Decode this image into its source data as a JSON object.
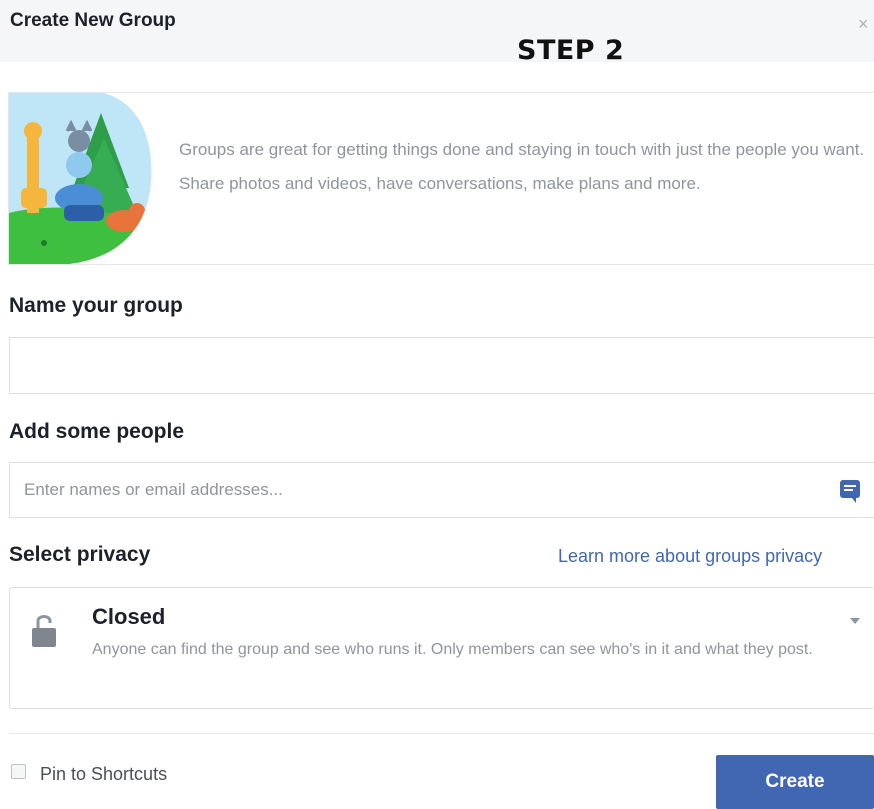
{
  "dialog": {
    "title": "Create New Group",
    "close_glyph": "×",
    "step_label": "STEP 2",
    "intro_text": "Groups are great for getting things done and staying in touch with just the people you want. Share photos and videos, have conversations, make plans and more.",
    "illustration_icon": "animals-illustration"
  },
  "name_section": {
    "label": "Name your group",
    "value": "",
    "placeholder": ""
  },
  "people_section": {
    "label": "Add some people",
    "value": "",
    "placeholder": "Enter names or email addresses...",
    "icon": "contacts-icon"
  },
  "privacy_section": {
    "label": "Select privacy",
    "learn_more": "Learn more about groups privacy",
    "selected_title": "Closed",
    "selected_desc": "Anyone can find the group and see who runs it. Only members can see who's in it and what they post.",
    "icon": "lock-icon"
  },
  "footer": {
    "pin_label": "Pin to Shortcuts",
    "pin_checked": false,
    "create_label": "Create"
  },
  "colors": {
    "brand_blue": "#4267b2",
    "muted_text": "#90949c",
    "header_bg": "#f5f6f7"
  }
}
